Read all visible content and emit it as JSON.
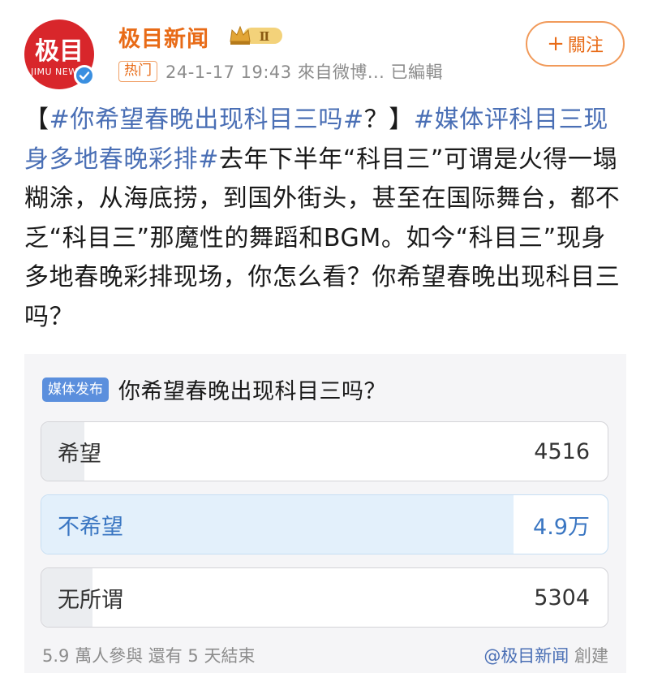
{
  "account": {
    "avatar_text": "极目",
    "avatar_sub": "JIMU NEW",
    "name": "极目新闻",
    "vip_level": "Ⅱ",
    "hot_tag": "热门",
    "meta": "24-1-17 19:43  來自微博...  已編輯",
    "follow_plus": "+",
    "follow_label": "關注"
  },
  "post": {
    "topic1": "#你希望春晚出现科目三吗#",
    "bracket_open": "【",
    "bracket_close": "？】",
    "topic2": "#媒体评科目三现身多地春晚彩排#",
    "body": "去年下半年“科目三”可谓是火得一塌糊涂，从海底捞，到国外街头，甚至在国际舞台，都不乏“科目三”那魔性的舞蹈和BGM。如今“科目三”现身多地春晚彩排现场，你怎么看？你希望春晚出现科目三吗？"
  },
  "poll": {
    "tag": "媒体发布",
    "title": "你希望春晚出现科目三吗？",
    "options": [
      {
        "label": "希望",
        "count": "4516",
        "share": 0.076
      },
      {
        "label": "不希望",
        "count": "4.9万",
        "share": 0.834
      },
      {
        "label": "无所谓",
        "count": "5304",
        "share": 0.09
      }
    ],
    "footer_left": "5.9 萬人參與  還有 5 天結束",
    "creator": "@极目新闻",
    "creator_suffix": " 創建"
  },
  "colors": {
    "brand_orange": "#e86b17",
    "topic_blue": "#4a6fb5",
    "avatar_red": "#d8262b",
    "poll_tag_blue": "#5b8fdd"
  }
}
